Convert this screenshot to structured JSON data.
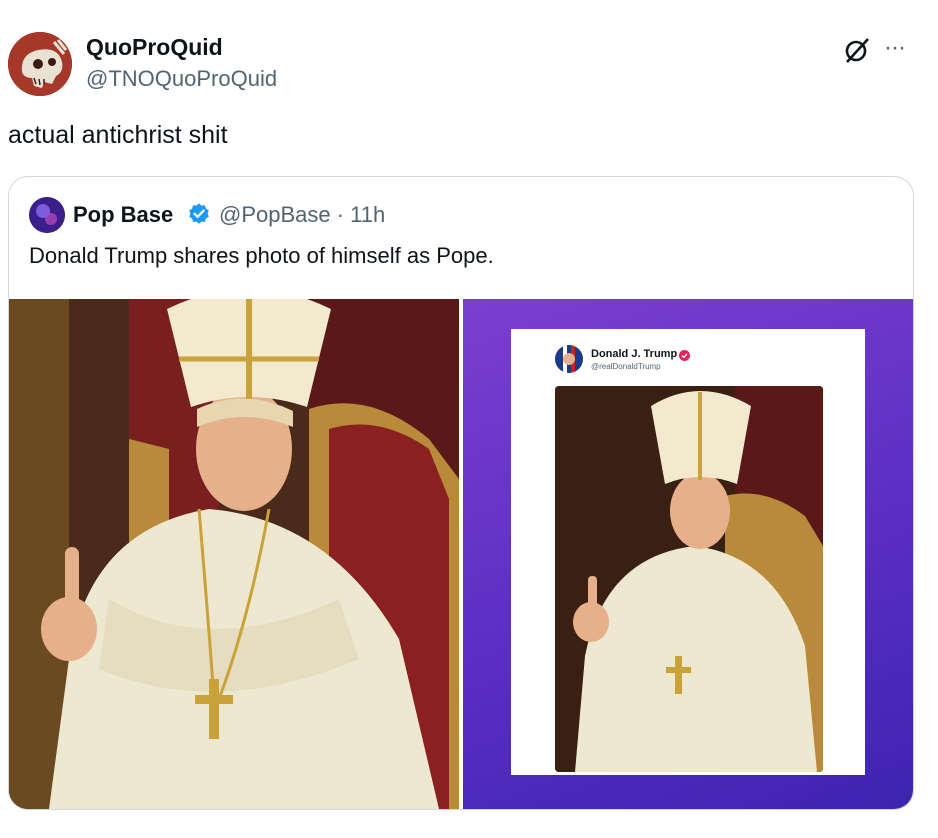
{
  "post": {
    "display_name": "QuoProQuid",
    "handle": "@TNOQuoProQuid",
    "text": "actual antichrist shit",
    "more_label": "···"
  },
  "quote": {
    "display_name": "Pop Base",
    "handle_time": "@PopBase · 11h",
    "text": "Donald Trump shares photo of himself as Pope."
  },
  "embedded_post": {
    "display_name": "Donald J. Trump",
    "handle": "@realDonaldTrump"
  },
  "colors": {
    "verified_blue": "#1d9bf0",
    "trump_badge": "#e0245e",
    "purple_bg": "#6a35c8"
  },
  "icons": [
    "grok-icon",
    "more-icon",
    "verified-badge-icon"
  ]
}
